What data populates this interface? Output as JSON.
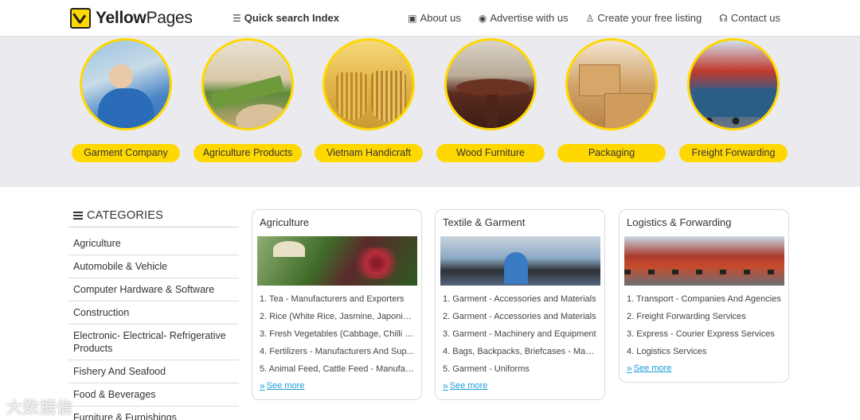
{
  "header": {
    "logo_text_bold": "Yellow",
    "logo_text_rest": "Pages",
    "quick_search": "Quick search Index",
    "nav": [
      {
        "label": "About us",
        "icon": "id-card-icon"
      },
      {
        "label": "Advertise with us",
        "icon": "target-icon"
      },
      {
        "label": "Create your free listing",
        "icon": "user-icon"
      },
      {
        "label": "Contact us",
        "icon": "headset-icon"
      }
    ]
  },
  "featured": [
    {
      "label": "Garment Company",
      "image": "garment-worker"
    },
    {
      "label": "Agriculture Products",
      "image": "rice-grains"
    },
    {
      "label": "Vietnam Handicraft",
      "image": "rattan-baskets"
    },
    {
      "label": "Wood Furniture",
      "image": "wooden-dining-table"
    },
    {
      "label": "Packaging",
      "image": "cardboard-boxes"
    },
    {
      "label": "Freight Forwarding",
      "image": "container-truck"
    }
  ],
  "categories": {
    "title": "CATEGORIES",
    "items": [
      "Agriculture",
      "Automobile & Vehicle",
      "Computer Hardware & Software",
      "Construction",
      "Electronic- Electrical- Refrigerative Products",
      "Fishery And Seafood",
      "Food & Beverages",
      "Furniture & Furnishings"
    ]
  },
  "cards": [
    {
      "title": "Agriculture",
      "items": [
        "1. Tea - Manufacturers and Exporters",
        "2. Rice (White Rice, Jasmine, Japonica...",
        "3. Fresh Vegetables (Cabbage, Chilli P...",
        "4. Fertilizers - Manufacturers And Sup...",
        "5. Animal Feed, Cattle Feed - Manufact..."
      ],
      "see_more": "See more"
    },
    {
      "title": "Textile & Garment",
      "items": [
        "1. Garment - Accessories and Materials",
        "2. Garment - Accessories and Materials",
        "3. Garment - Machinery and Equipment",
        "4. Bags, Backpacks, Briefcases - Manuf...",
        "5. Garment - Uniforms"
      ],
      "see_more": "See more"
    },
    {
      "title": "Logistics & Forwarding",
      "items": [
        "1. Transport - Companies And Agencies",
        "2. Freight Forwarding Services",
        "3. Express - Courier Express Services",
        "4. Logistics Services"
      ],
      "see_more": "See more"
    }
  ],
  "watermark": "大数据信",
  "colors": {
    "accent": "#ffd800",
    "link": "#1a9bd7",
    "band_bg": "#ebebef"
  }
}
